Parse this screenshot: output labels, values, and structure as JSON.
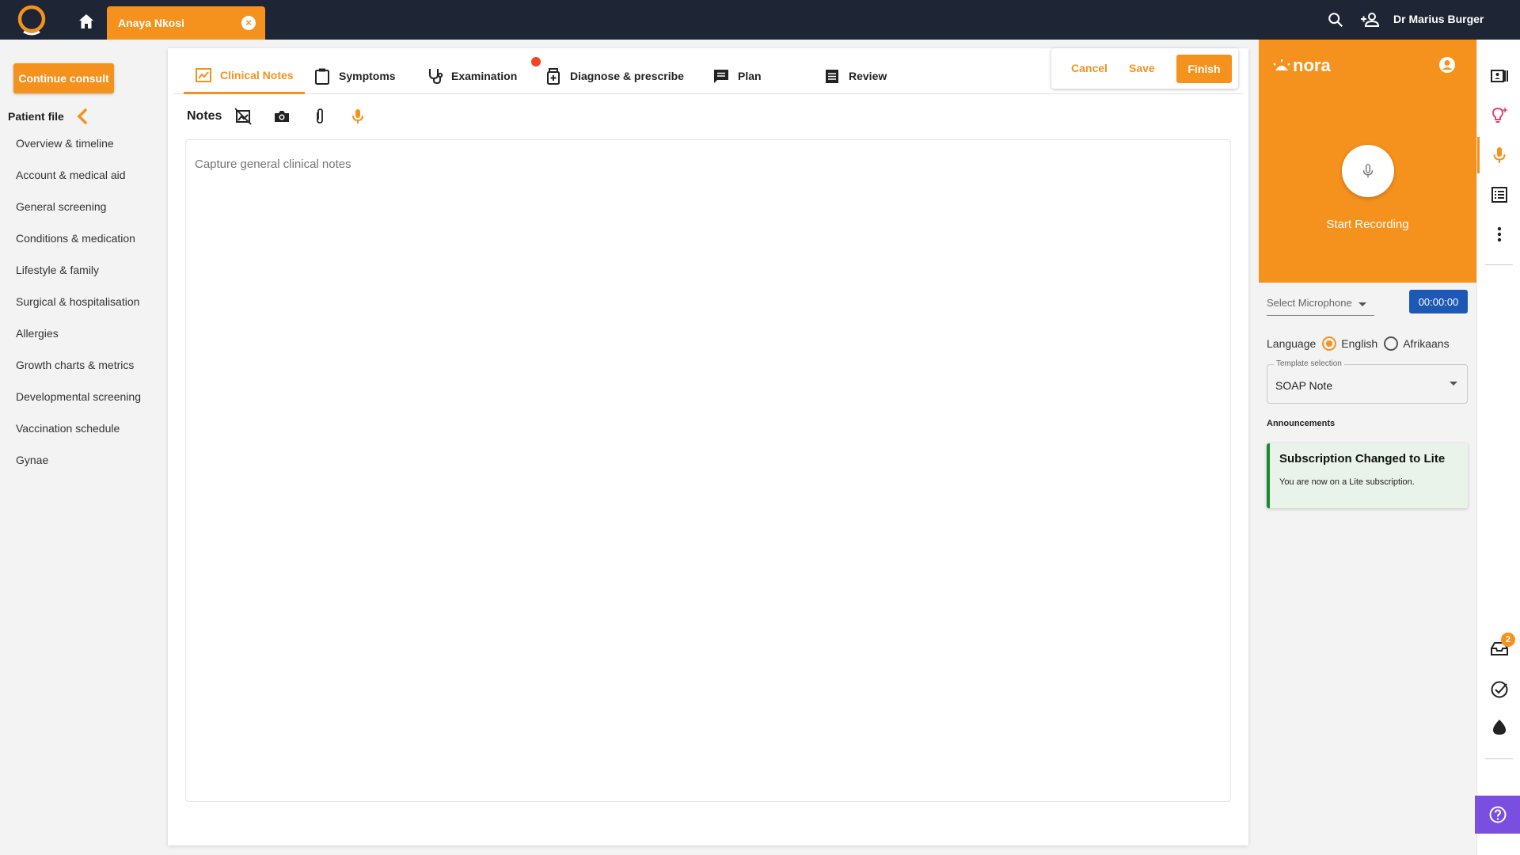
{
  "topbar": {
    "patient_tab": "Anaya Nkosi",
    "user_name": "Dr Marius Burger"
  },
  "sidebar": {
    "continue_label": "Continue consult",
    "patient_file_label": "Patient file",
    "items": [
      {
        "label": "Overview & timeline"
      },
      {
        "label": "Account & medical aid"
      },
      {
        "label": "General screening"
      },
      {
        "label": "Conditions & medication"
      },
      {
        "label": "Lifestyle & family"
      },
      {
        "label": "Surgical & hospitalisation"
      },
      {
        "label": "Allergies"
      },
      {
        "label": "Growth charts & metrics"
      },
      {
        "label": "Developmental screening"
      },
      {
        "label": "Vaccination schedule"
      },
      {
        "label": "Gynae"
      }
    ]
  },
  "main": {
    "tabs": [
      {
        "label": "Clinical Notes",
        "icon": "clinical-notes-icon",
        "active": true
      },
      {
        "label": "Symptoms",
        "icon": "clipboard-icon"
      },
      {
        "label": "Examination",
        "icon": "stethoscope-icon"
      },
      {
        "label": "Diagnose & prescribe",
        "icon": "medicine-bottle-icon",
        "badge": true
      },
      {
        "label": "Plan",
        "icon": "chat-lines-icon"
      },
      {
        "label": "Review",
        "icon": "document-lines-icon"
      }
    ],
    "actions": {
      "cancel": "Cancel",
      "save": "Save",
      "finish": "Finish"
    },
    "notes": {
      "label": "Notes",
      "placeholder": "Capture general clinical notes",
      "tool_icons": [
        "image-off-icon",
        "camera-icon",
        "paperclip-icon",
        "microphone-icon"
      ]
    }
  },
  "nora": {
    "brand": "nora",
    "start_recording": "Start Recording",
    "select_microphone": "Select Microphone",
    "timer": "00:00:00",
    "language_label": "Language",
    "languages": [
      {
        "label": "English",
        "selected": true
      },
      {
        "label": "Afrikaans",
        "selected": false
      }
    ],
    "template_legend": "Template selection",
    "template_value": "SOAP Note",
    "announcements_label": "Announcements",
    "announcement": {
      "title": "Subscription Changed to Lite",
      "body": "You are now on a Lite subscription."
    }
  },
  "rail": {
    "badge_count": "2"
  },
  "colors": {
    "accent": "#f5921e",
    "topbar": "#1e2535",
    "timer": "#1e58b5",
    "announce_border": "#1b8a2e",
    "help": "#7a4fe0",
    "badge": "#f44326"
  }
}
